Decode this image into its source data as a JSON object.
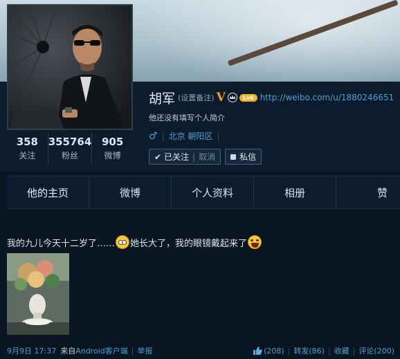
{
  "profile": {
    "name": "胡军",
    "remark_link": "(设置备注)",
    "verified_badge": "V",
    "level_badge": "Lv6",
    "url": "http://weibo.com/u/1880246651",
    "bio": "他还没有填写个人简介",
    "gender_symbol": "♂",
    "location": "北京 朝阳区"
  },
  "stats": [
    {
      "num": "358",
      "label": "关注"
    },
    {
      "num": "355764",
      "label": "粉丝"
    },
    {
      "num": "905",
      "label": "微博"
    }
  ],
  "actions": {
    "followed_label": "已关注",
    "unfollow_label": "取消",
    "message_label": "私信"
  },
  "tabs": [
    "他的主页",
    "微博",
    "个人资料",
    "相册",
    "赞"
  ],
  "post": {
    "text_part1": "我的九儿今天十二岁了……",
    "text_part2": "她长大了，我的眼镜戴起来了",
    "time": "9月9日 17:37",
    "source_prefix": "来自",
    "source": "Android客户端",
    "report": "举报",
    "likes": "(208)",
    "repost": "转发(86)",
    "favorite": "收藏",
    "comment": "评论(200)"
  },
  "icons": {
    "check": "check-icon",
    "message": "message-icon",
    "thumb": "thumbs-up-icon",
    "emoji1": "surprised-emoji-icon",
    "emoji2": "laugh-emoji-icon"
  },
  "colors": {
    "background": "#0a1522",
    "link": "#4e9fd6",
    "verified": "#f0a11c"
  }
}
